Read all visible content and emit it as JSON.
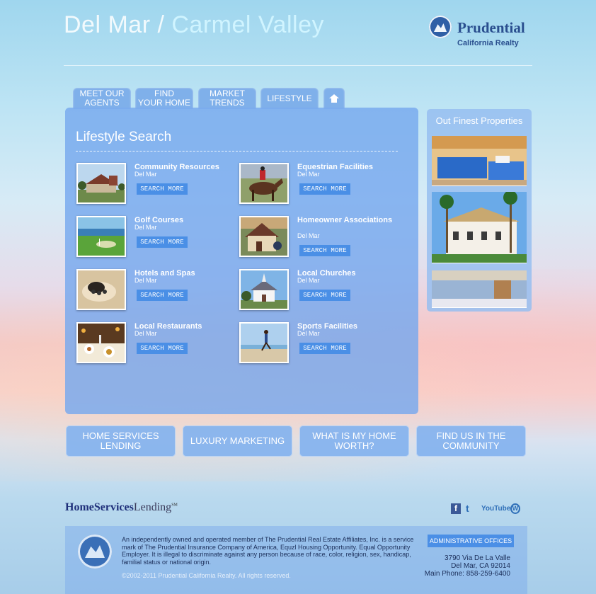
{
  "header": {
    "title_part1": "Del Mar /",
    "title_part2": "Carmel Valley",
    "brand_name": "Prudential",
    "brand_sub": "California Realty"
  },
  "nav": {
    "tabs": [
      {
        "line1": "MEET OUR",
        "line2": "AGENTS"
      },
      {
        "line1": "FIND",
        "line2": "YOUR HOME"
      },
      {
        "line1": "MARKET",
        "line2": "TRENDS"
      },
      {
        "line1": "LIFESTYLE",
        "line2": ""
      }
    ],
    "home_icon": "home-icon"
  },
  "main": {
    "heading": "Lifestyle Search",
    "items": [
      {
        "title": "Community Resources",
        "location": "Del Mar",
        "button": "SEARCH MORE"
      },
      {
        "title": "Equestrian Facilities",
        "location": "Del Mar",
        "button": "SEARCH MORE"
      },
      {
        "title": "Golf Courses",
        "location": "Del Mar",
        "button": "SEARCH MORE"
      },
      {
        "title": "Homeowner Associations",
        "location": "Del Mar",
        "button": "SEARCH MORE"
      },
      {
        "title": "Hotels and Spas",
        "location": "Del Mar",
        "button": "SEARCH MORE"
      },
      {
        "title": "Local Churches",
        "location": "Del Mar",
        "button": "SEARCH MORE"
      },
      {
        "title": "Local Restaurants",
        "location": "Del Mar",
        "button": "SEARCH MORE"
      },
      {
        "title": "Sports Facilities",
        "location": "Del Mar",
        "button": "SEARCH MORE"
      }
    ]
  },
  "sidebar": {
    "title": "Out Finest Properties"
  },
  "bottom_buttons": [
    {
      "line1": "HOME SERVICES",
      "line2": "LENDING"
    },
    {
      "line1": "LUXURY MARKETING",
      "line2": ""
    },
    {
      "line1": "WHAT IS MY HOME",
      "line2": "WORTH?"
    },
    {
      "line1": "FIND US IN THE",
      "line2": "COMMUNITY"
    }
  ],
  "partner": {
    "bold": "HomeServices",
    "light": "Lending",
    "mark": "SM"
  },
  "social": {
    "facebook": "f",
    "twitter": "t",
    "youtube": "YouTube",
    "wordpress": "W"
  },
  "footer": {
    "disclaimer": "An independently owned and operated member of The Prudential Real Estate Affiliates, Inc. is a service mark of The Prudential Insurance Company of America, Equzl Housing Opportunity. Equal Opportunity Employer. It is illegal to discriminate against any person because of race, color, religion, sex, handicap, familial status or national origin.",
    "copyright": "©2002-2011 Prudential California Realty. All rights reserved.",
    "admin_label": "ADMINISTRATIVE OFFICES",
    "address_line1": "3790 Via De La Valle",
    "address_line2": "Del Mar, CA   92014",
    "phone": "Main Phone:  858-259-6400"
  }
}
